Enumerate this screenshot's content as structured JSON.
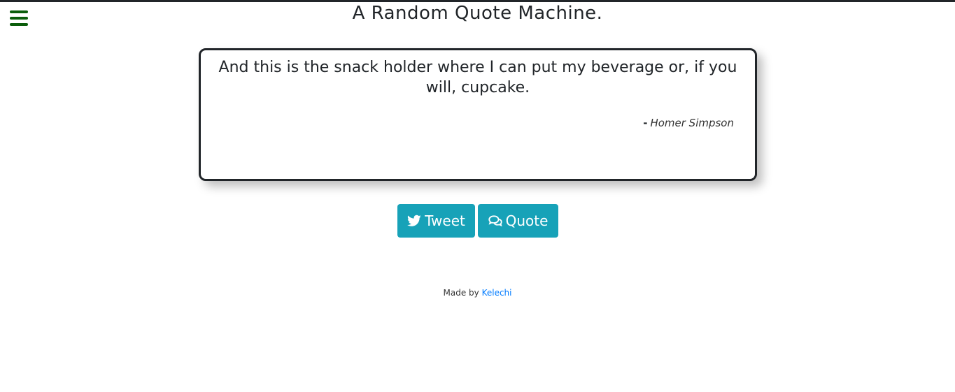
{
  "header": {
    "title": "A Random Quote Machine.",
    "menu_icon": "hamburger-icon",
    "menu_color": "#0b5d0b"
  },
  "quote": {
    "text": "And this is the snack holder where I can put my beverage or, if you will, cupcake.",
    "dash": "-",
    "author": "Homer Simpson"
  },
  "actions": {
    "tweet_label": "Tweet",
    "tweet_icon": "twitter-icon",
    "quote_label": "Quote",
    "quote_icon": "comments-icon",
    "button_color": "#17a2b8"
  },
  "footer": {
    "prefix": "Made by",
    "author_link": "Kelechi",
    "link_color": "#007bff"
  }
}
